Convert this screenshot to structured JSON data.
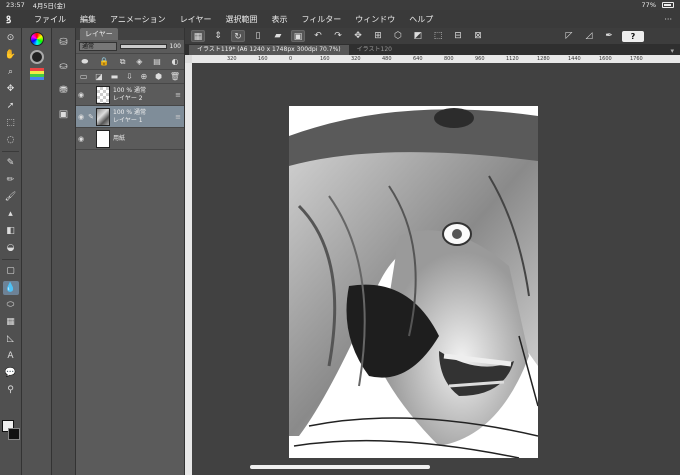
{
  "status": {
    "time": "23:57",
    "date": "4月5日(金)",
    "battery": "77%"
  },
  "menu": {
    "items": [
      "ファイル",
      "編集",
      "アニメーション",
      "レイヤー",
      "選択範囲",
      "表示",
      "フィルター",
      "ウィンドウ",
      "ヘルプ"
    ],
    "overflow": "···"
  },
  "layer_panel": {
    "tab": "レイヤー",
    "blend_mode": "通常",
    "opacity": "100",
    "layers": [
      {
        "line1": "100 % 通常",
        "line2": "レイヤー 2",
        "selected": false,
        "thumb": "transparent"
      },
      {
        "line1": "100 % 通常",
        "line2": "レイヤー 1",
        "selected": true,
        "thumb": "image"
      },
      {
        "line1": "",
        "line2": "用紙",
        "selected": false,
        "thumb": "paper"
      }
    ]
  },
  "document": {
    "active_tab": "イラスト119* (A6 1240 x 1748px 300dpi 70.7%)",
    "inactive_tab": "イラスト120"
  },
  "ruler_ticks": [
    "320",
    "160",
    "0",
    "160",
    "320",
    "480",
    "640",
    "800",
    "960",
    "1120",
    "1280",
    "1440",
    "1600",
    "1760"
  ],
  "colors": {
    "accent": "#6d8296",
    "selected_layer": "#7f8d99",
    "canvas_bg": "#414141"
  }
}
